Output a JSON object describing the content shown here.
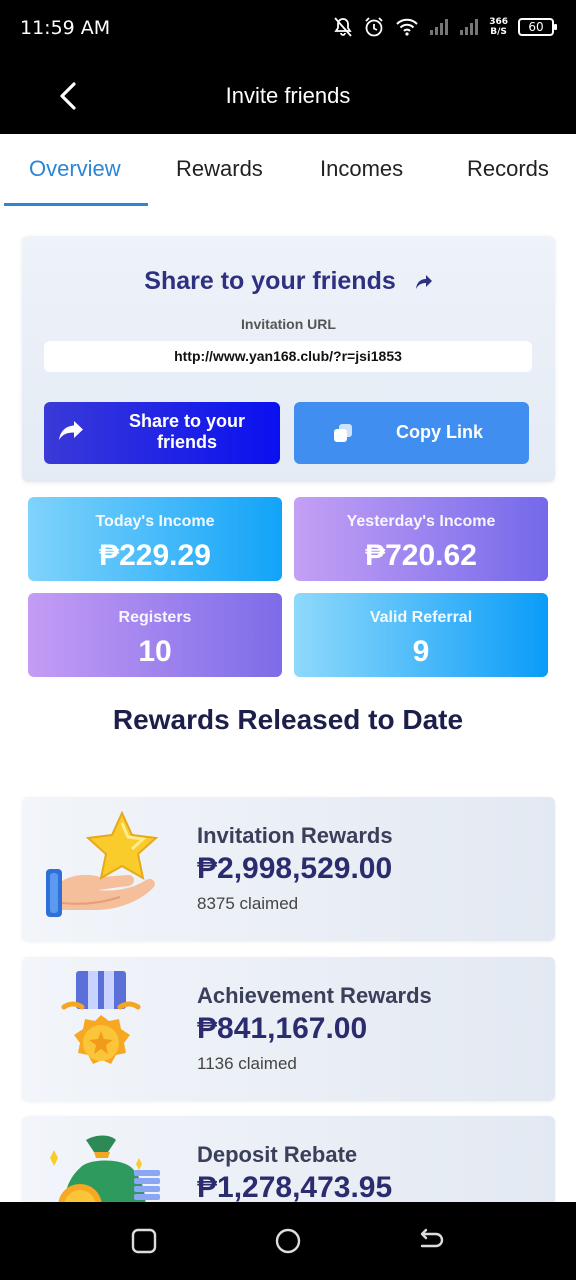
{
  "status_bar": {
    "time": "11:59 AM",
    "net_speed_value": "366",
    "net_speed_unit": "B/S",
    "battery": "60"
  },
  "header": {
    "title": "Invite friends"
  },
  "tabs": [
    {
      "label": "Overview",
      "active": true
    },
    {
      "label": "Rewards",
      "active": false
    },
    {
      "label": "Incomes",
      "active": false
    },
    {
      "label": "Records",
      "active": false
    }
  ],
  "share": {
    "title": "Share to your friends",
    "url_label": "Invitation URL",
    "url": "http://www.yan168.club/?r=jsi1853",
    "share_button": "Share to your friends",
    "copy_button": "Copy Link"
  },
  "stats": {
    "today": {
      "label": "Today's Income",
      "value": "₱229.29"
    },
    "yesterday": {
      "label": "Yesterday's Income",
      "value": "₱720.62"
    },
    "registers": {
      "label": "Registers",
      "value": "10"
    },
    "valid": {
      "label": "Valid Referral",
      "value": "9"
    }
  },
  "rewards_heading": "Rewards Released to Date",
  "rewards": [
    {
      "name": "Invitation Rewards",
      "amount": "₱2,998,529.00",
      "claimed": "8375 claimed",
      "icon": "hand-star-icon"
    },
    {
      "name": "Achievement Rewards",
      "amount": "₱841,167.00",
      "claimed": "1136 claimed",
      "icon": "medal-icon"
    },
    {
      "name": "Deposit Rebate",
      "amount": "₱1,278,473.95",
      "claimed": "",
      "icon": "money-bag-icon"
    }
  ],
  "colors": {
    "accent": "#2b86d6",
    "title": "#2e3080",
    "share_button": "#0a10f0",
    "copy_button": "#3f8ef0"
  }
}
